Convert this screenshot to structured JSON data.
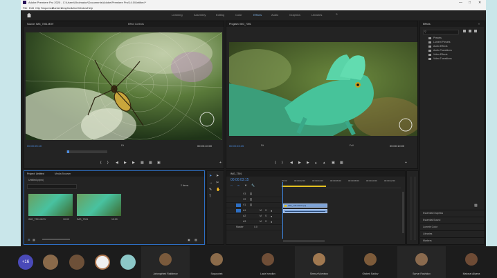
{
  "window": {
    "title": "Adobe Premiere Pro 2020 - C:\\Users\\Kholmatov\\Documents\\Adobe\\Premiere Pro\\14.0\\Untitled *",
    "menus": [
      "File",
      "Edit",
      "Clip",
      "Sequence",
      "Markers",
      "Graphics",
      "View",
      "Window",
      "Help"
    ]
  },
  "workspaces": {
    "items": [
      "Learning",
      "Assembly",
      "Editing",
      "Color",
      "Effects",
      "Audio",
      "Graphics",
      "Libraries"
    ],
    "active": "Effects"
  },
  "source_monitor": {
    "tab": "Source: IMG_7391.MOV",
    "tab2": "Effect Controls",
    "timecode_left": "00:00:05:10",
    "fit": "Fit",
    "timecode_right": "00:00:10:00"
  },
  "program_monitor": {
    "tab": "Program: IMG_7391",
    "timecode_left": "00:00:03:15",
    "fit": "Fit",
    "quality": "Full",
    "timecode_right": "00:00:10:00"
  },
  "effects_panel": {
    "title": "Effects",
    "items": [
      "Presets",
      "Lumetri Presets",
      "Audio Effects",
      "Audio Transitions",
      "Video Effects",
      "Video Transitions"
    ]
  },
  "effects_sections": [
    "Essential Graphics",
    "Essential Sound",
    "Lumetri Color",
    "Libraries",
    "Markers"
  ],
  "project_panel": {
    "tab": "Project: Untitled",
    "tab2": "Media Browser",
    "project_name": "Untitled.prproj",
    "item_count": "2 items",
    "clips": [
      {
        "name": "IMG_7391.MOV",
        "duration": "10:00"
      },
      {
        "name": "IMG_7391",
        "duration": "10:00"
      }
    ]
  },
  "timeline": {
    "tab": "IMG_7391",
    "timecode": "00:00:03:15",
    "ruler": [
      "00:00",
      "00:00:02:00",
      "00:00:04:00",
      "00:00:06:00",
      "00:00:08:00",
      "00:00:10:00",
      "00:00:12:00",
      "00:00:14:00"
    ],
    "video_tracks": [
      "V3",
      "V2",
      "V1"
    ],
    "audio_tracks": [
      "A1",
      "A2",
      "A3"
    ],
    "master": "Master",
    "master_value": "0.0",
    "video_clip": "IMG_7391.MOV [V]",
    "audio_clip": ""
  },
  "taskbar": {
    "participants_badge": "+16",
    "participants": [
      {
        "name": "Jahongirbek Rakhimov",
        "color": "#7a5a3c"
      },
      {
        "name": "Sayvyobek",
        "color": "#8b6b4a"
      },
      {
        "name": "Laziz Ismoilov",
        "color": "#6f4e37"
      },
      {
        "name": "Sheroz Muminov",
        "color": "#a07850"
      },
      {
        "name": "Otabek Saidov",
        "color": "#7d5b3a"
      },
      {
        "name": "Sarvar Rashidov",
        "color": "#8a6a4e"
      },
      {
        "name": "Matonat Aliyeva",
        "color": "#6e4b35"
      }
    ]
  },
  "colors": {
    "accent_blue": "#4d8de0",
    "clip_blue": "#7ea3d6",
    "playhead": "#3f8ae8",
    "workarea": "#e5c220"
  }
}
